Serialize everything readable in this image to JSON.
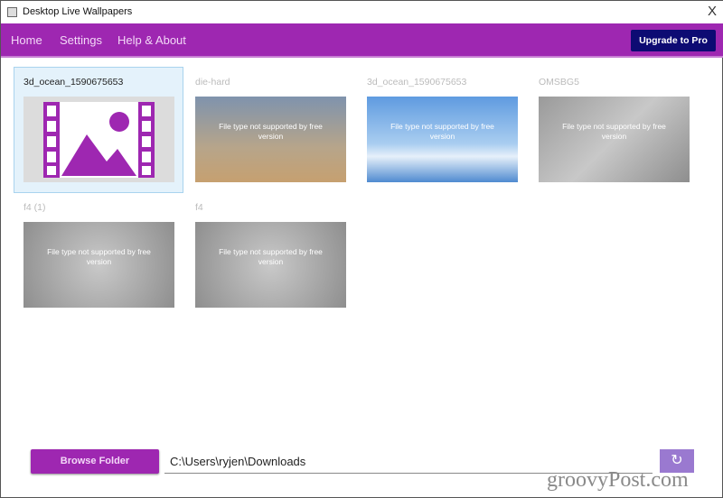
{
  "window": {
    "title": "Desktop Live Wallpapers",
    "close": "X"
  },
  "nav": {
    "items": [
      "Home",
      "Settings",
      "Help & About"
    ],
    "upgrade": "Upgrade to Pro"
  },
  "tiles": [
    {
      "label": "3d_ocean_1590675653",
      "selected": true,
      "message": ""
    },
    {
      "label": "die-hard",
      "message": "File type not supported by free version"
    },
    {
      "label": "3d_ocean_1590675653",
      "message": "File type not supported by free version"
    },
    {
      "label": "OMSBG5",
      "message": "File type not supported by free version"
    },
    {
      "label": "f4 (1)",
      "message": "File type not supported by free version"
    },
    {
      "label": "f4",
      "message": "File type not supported by free version"
    }
  ],
  "footer": {
    "browse": "Browse Folder",
    "path": "C:\\Users\\ryjen\\Downloads",
    "refresh_icon": "refresh-icon"
  },
  "watermark": "groovyPost.com",
  "colors": {
    "accent": "#9e27b1",
    "upgrade": "#0d0b73",
    "refresh": "#9a79d0"
  }
}
